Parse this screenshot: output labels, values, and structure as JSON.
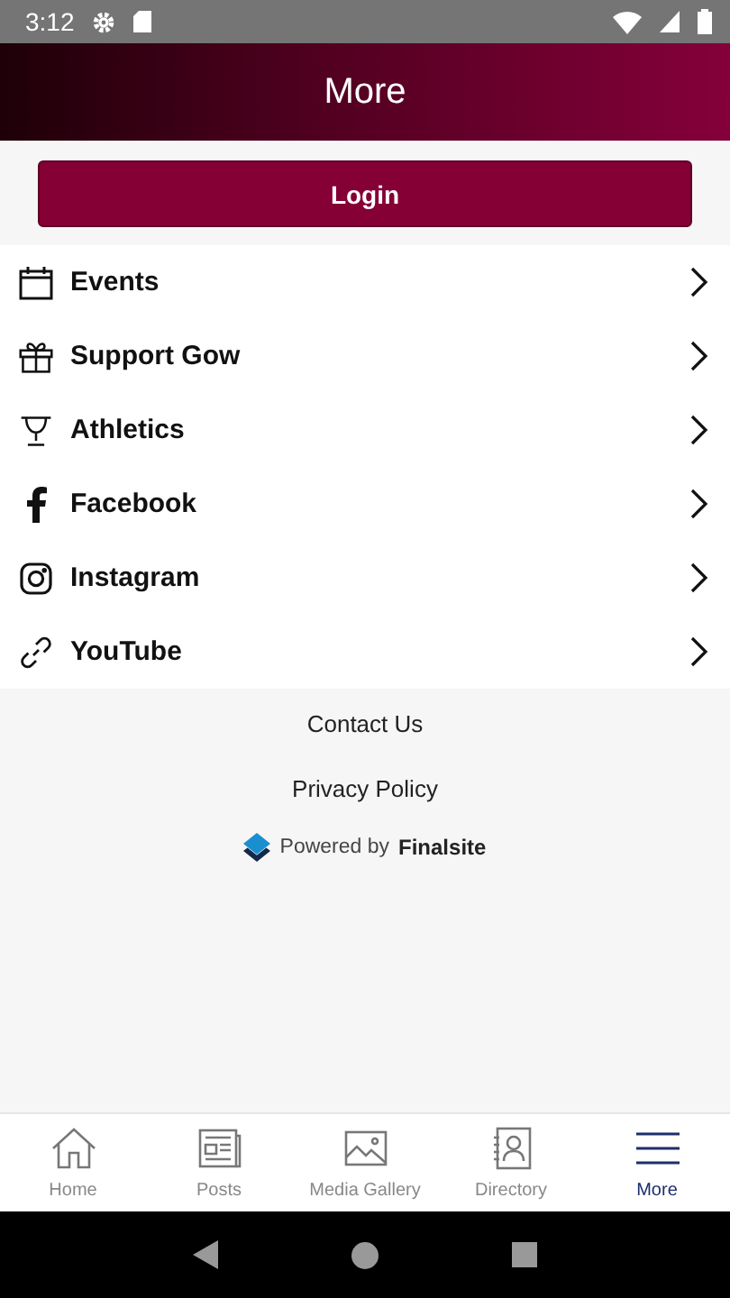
{
  "status_bar": {
    "time": "3:12"
  },
  "header": {
    "title": "More"
  },
  "login_button": "Login",
  "menu": [
    {
      "label": "Events",
      "kind": "calendar"
    },
    {
      "label": "Support Gow",
      "kind": "gift"
    },
    {
      "label": "Athletics",
      "kind": "trophy"
    },
    {
      "label": "Facebook",
      "kind": "facebook"
    },
    {
      "label": "Instagram",
      "kind": "instagram"
    },
    {
      "label": "YouTube",
      "kind": "link"
    }
  ],
  "footer_links": [
    "Contact Us",
    "Privacy Policy"
  ],
  "powered_by": {
    "prefix": "Powered by",
    "brand": "Finalsite"
  },
  "tabs": [
    {
      "label": "Home",
      "kind": "home",
      "selected": false
    },
    {
      "label": "Posts",
      "kind": "posts",
      "selected": false
    },
    {
      "label": "Media Gallery",
      "kind": "gallery",
      "selected": false
    },
    {
      "label": "Directory",
      "kind": "directory",
      "selected": false
    },
    {
      "label": "More",
      "kind": "menu",
      "selected": true
    }
  ]
}
